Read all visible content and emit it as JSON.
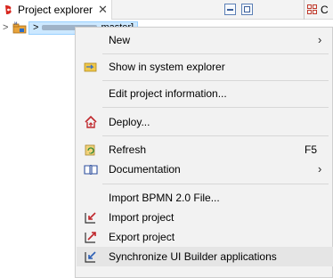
{
  "tab": {
    "label": "Project explorer",
    "close_glyph": "✕",
    "right_label": "C",
    "icons": [
      "bonita-app-icon",
      "minimize-icon",
      "maximize-icon",
      "outline-icon"
    ]
  },
  "tree": {
    "twisty": ">",
    "project_prefix": ">",
    "project_suffix": "master]",
    "icon": "maven-project-icon"
  },
  "menu": {
    "items": [
      {
        "label": "New",
        "submenu_glyph": "›",
        "icon": ""
      },
      {
        "label": "Show in system explorer",
        "icon": "open-folder-arrow-icon"
      },
      {
        "label": "Edit project information...",
        "icon": ""
      },
      {
        "label": "Deploy...",
        "icon": "deploy-house-icon"
      },
      {
        "label": "Refresh",
        "accelerator": "F5",
        "icon": "refresh-icon"
      },
      {
        "label": "Documentation",
        "submenu_glyph": "›",
        "icon": "book-icon"
      },
      {
        "label": "Import BPMN 2.0 File...",
        "icon": ""
      },
      {
        "label": "Import project",
        "icon": "import-arrow-icon"
      },
      {
        "label": "Export project",
        "icon": "export-arrow-icon"
      },
      {
        "label": "Synchronize UI Builder applications",
        "icon": "sync-arrow-icon"
      }
    ],
    "colors": {
      "background": "#f2f2f2",
      "hover": "#e5e5e5",
      "separator": "#d7d7d7"
    }
  }
}
